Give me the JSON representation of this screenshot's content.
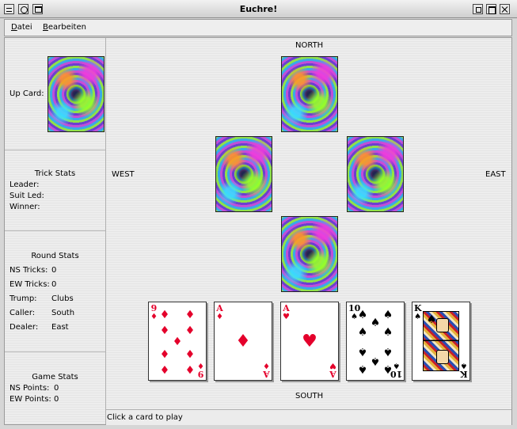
{
  "window": {
    "title": "Euchre!"
  },
  "menu": {
    "items": [
      {
        "mnemonic": "D",
        "rest": "atei"
      },
      {
        "mnemonic": "B",
        "rest": "earbeiten"
      }
    ]
  },
  "sidebar": {
    "up_card_label": "Up Card:",
    "trick_stats": {
      "title": "Trick Stats",
      "leader_label": "Leader:",
      "leader_value": "",
      "suit_led_label": "Suit Led:",
      "suit_led_value": "",
      "winner_label": "Winner:",
      "winner_value": ""
    },
    "round_stats": {
      "title": "Round Stats",
      "ns_tricks_label": "NS Tricks:",
      "ns_tricks_value": "0",
      "ew_tricks_label": "EW Tricks:",
      "ew_tricks_value": "0",
      "trump_label": "Trump:",
      "trump_value": "Clubs",
      "caller_label": "Caller:",
      "caller_value": "South",
      "dealer_label": "Dealer:",
      "dealer_value": "East"
    },
    "game_stats": {
      "title": "Game Stats",
      "ns_points_label": "NS Points:",
      "ns_points_value": "0",
      "ew_points_label": "EW Points:",
      "ew_points_value": "0"
    }
  },
  "table": {
    "north_label": "NORTH",
    "south_label": "SOUTH",
    "west_label": "WEST",
    "east_label": "EAST"
  },
  "hand": [
    {
      "rank": "9",
      "suit": "♦",
      "color": "red",
      "name": "nine-of-diamonds"
    },
    {
      "rank": "A",
      "suit": "♦",
      "color": "red",
      "name": "ace-of-diamonds"
    },
    {
      "rank": "A",
      "suit": "♥",
      "color": "red",
      "name": "ace-of-hearts"
    },
    {
      "rank": "10",
      "suit": "♠",
      "color": "black",
      "name": "ten-of-spades"
    },
    {
      "rank": "K",
      "suit": "♠",
      "color": "black",
      "name": "king-of-spades"
    }
  ],
  "status": {
    "text": "Click a card to play"
  },
  "colors": {
    "red_suit": "#e4002b",
    "black_suit": "#000000"
  }
}
